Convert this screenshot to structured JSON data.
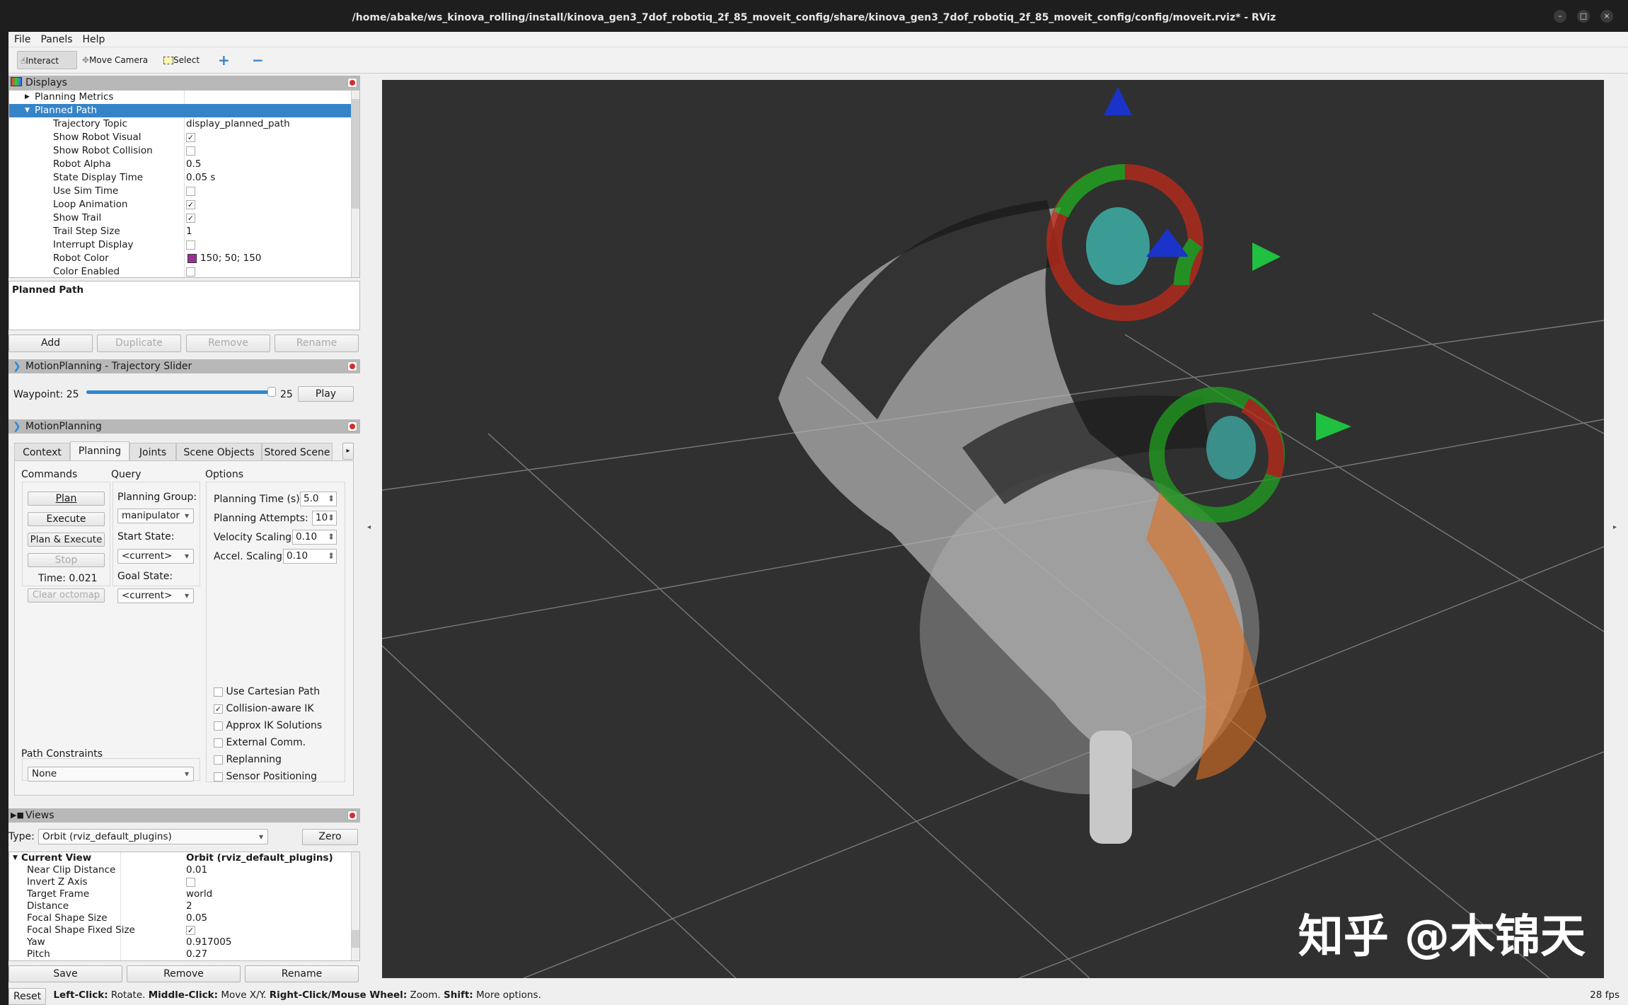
{
  "window": {
    "title": "/home/abake/ws_kinova_rolling/install/kinova_gen3_7dof_robotiq_2f_85_moveit_config/share/kinova_gen3_7dof_robotiq_2f_85_moveit_config/config/moveit.rviz* - RViz",
    "min": "–",
    "max": "□",
    "close": "×"
  },
  "menu": [
    "File",
    "Panels",
    "Help"
  ],
  "toolbar": {
    "interact": "Interact",
    "move_camera": "Move Camera",
    "select": "Select",
    "plus": "+",
    "minus": "−"
  },
  "displays": {
    "title": "Displays",
    "items": [
      {
        "label": "Planning Metrics",
        "value": "",
        "type": "group-collapsed"
      },
      {
        "label": "Planned Path",
        "value": "",
        "type": "group-expanded"
      },
      {
        "label": "Trajectory Topic",
        "value": "display_planned_path",
        "type": "text"
      },
      {
        "label": "Show Robot Visual",
        "value": "✓",
        "type": "check"
      },
      {
        "label": "Show Robot Collision",
        "value": "",
        "type": "check"
      },
      {
        "label": "Robot Alpha",
        "value": "0.5",
        "type": "text"
      },
      {
        "label": "State Display Time",
        "value": "0.05 s",
        "type": "text"
      },
      {
        "label": "Use Sim Time",
        "value": "",
        "type": "check"
      },
      {
        "label": "Loop Animation",
        "value": "✓",
        "type": "check"
      },
      {
        "label": "Show Trail",
        "value": "✓",
        "type": "check"
      },
      {
        "label": "Trail Step Size",
        "value": "1",
        "type": "text"
      },
      {
        "label": "Interrupt Display",
        "value": "",
        "type": "check"
      },
      {
        "label": "Robot Color",
        "value": "150; 50; 150",
        "type": "color"
      },
      {
        "label": "Color Enabled",
        "value": "",
        "type": "check"
      }
    ],
    "robot_color": "#963296",
    "description": "Planned Path",
    "buttons": [
      "Add",
      "Duplicate",
      "Remove",
      "Rename"
    ]
  },
  "slider": {
    "title": "MotionPlanning - Trajectory Slider",
    "label": "Waypoint:",
    "value": "25",
    "max": "25",
    "position": 1.0,
    "play": "Play"
  },
  "motion": {
    "title": "MotionPlanning",
    "tabs": [
      "Context",
      "Planning",
      "Joints",
      "Scene Objects",
      "Stored Scene"
    ],
    "commands_label": "Commands",
    "query_label": "Query",
    "options_label": "Options",
    "plan": "Plan",
    "execute": "Execute",
    "plan_execute": "Plan & Execute",
    "stop": "Stop",
    "time": "Time: 0.021",
    "clear": "Clear octomap",
    "group_label": "Planning Group:",
    "group": "manipulator",
    "start_label": "Start State:",
    "start": "<current>",
    "goal_label": "Goal State:",
    "goal": "<current>",
    "opts": [
      {
        "label": "Planning Time (s):",
        "value": "5.0"
      },
      {
        "label": "Planning Attempts:",
        "value": "10"
      },
      {
        "label": "Velocity Scaling:",
        "value": "0.10"
      },
      {
        "label": "Accel. Scaling:",
        "value": "0.10"
      }
    ],
    "checks": [
      {
        "label": "Use Cartesian Path",
        "checked": ""
      },
      {
        "label": "Collision-aware IK",
        "checked": "✓"
      },
      {
        "label": "Approx IK Solutions",
        "checked": ""
      },
      {
        "label": "External Comm.",
        "checked": ""
      },
      {
        "label": "Replanning",
        "checked": ""
      },
      {
        "label": "Sensor Positioning",
        "checked": ""
      }
    ],
    "constraints_label": "Path Constraints",
    "constraints": "None"
  },
  "views": {
    "title": "Views",
    "type_label": "Type:",
    "type": "Orbit (rviz_default_plugins)",
    "zero": "Zero",
    "items": [
      {
        "label": "Current View",
        "value": "Orbit (rviz_default_plugins)"
      },
      {
        "label": "Near Clip Distance",
        "value": "0.01"
      },
      {
        "label": "Invert Z Axis",
        "value": ""
      },
      {
        "label": "Target Frame",
        "value": "world"
      },
      {
        "label": "Distance",
        "value": "2"
      },
      {
        "label": "Focal Shape Size",
        "value": "0.05"
      },
      {
        "label": "Focal Shape Fixed Size",
        "value": "✓"
      },
      {
        "label": "Yaw",
        "value": "0.917005"
      },
      {
        "label": "Pitch",
        "value": "0.27"
      }
    ],
    "buttons": [
      "Save",
      "Remove",
      "Rename"
    ]
  },
  "status": {
    "reset": "Reset",
    "k1": "Left-Click:",
    "t1": " Rotate. ",
    "k2": "Middle-Click:",
    "t2": " Move X/Y. ",
    "k3": "Right-Click/Mouse Wheel:",
    "t3": " Zoom. ",
    "k4": "Shift:",
    "t4": " More options.",
    "fps": "28 fps"
  },
  "watermark": "知乎 @木锦天"
}
